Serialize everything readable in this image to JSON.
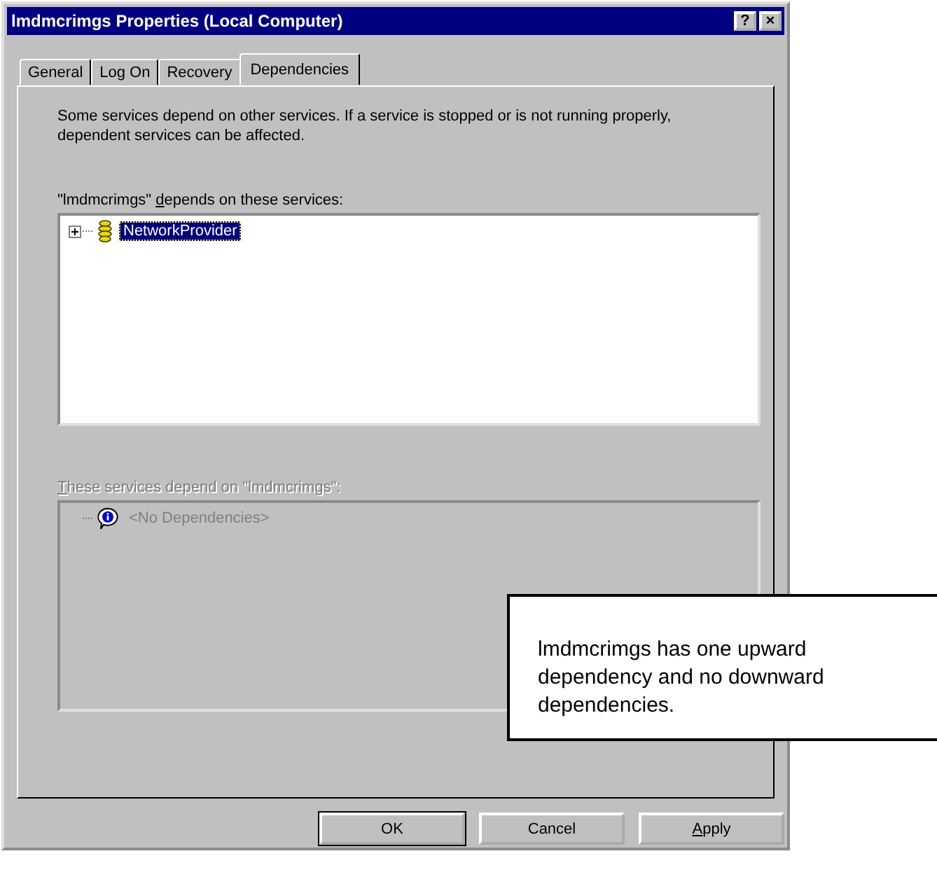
{
  "window": {
    "title": "lmdmcrimgs Properties (Local Computer)",
    "title_buttons": [
      "?",
      "×"
    ]
  },
  "tabs": [
    {
      "label": "General",
      "selected": false
    },
    {
      "label": "Log On",
      "selected": false
    },
    {
      "label": "Recovery",
      "selected": false
    },
    {
      "label": "Dependencies",
      "selected": true
    }
  ],
  "description": "Some services depend on other services. If a service is stopped or is not running properly, dependent services can be affected.",
  "lists": [
    {
      "label": {
        "before": "\"lmdmcrimgs\" ",
        "key": "d",
        "after": "epends on these services:"
      },
      "disabled": false,
      "items": [
        {
          "label": "NetworkProvider",
          "kind": "service",
          "expandable": true,
          "selected": true
        }
      ]
    },
    {
      "label": {
        "key": "T",
        "after": "hese services depend on \"lmdmcrimgs\":"
      },
      "disabled": true,
      "items": [
        {
          "label": "<No Dependencies>",
          "kind": "info",
          "expandable": false,
          "selected": false
        }
      ]
    }
  ],
  "buttons": [
    {
      "after": "OK",
      "default": true
    },
    {
      "after": "Cancel",
      "default": false
    },
    {
      "key": "A",
      "after": "pply",
      "default": false
    }
  ],
  "callout": {
    "text": "lmdmcrimgs has one upward dependency and no downward dependencies."
  }
}
